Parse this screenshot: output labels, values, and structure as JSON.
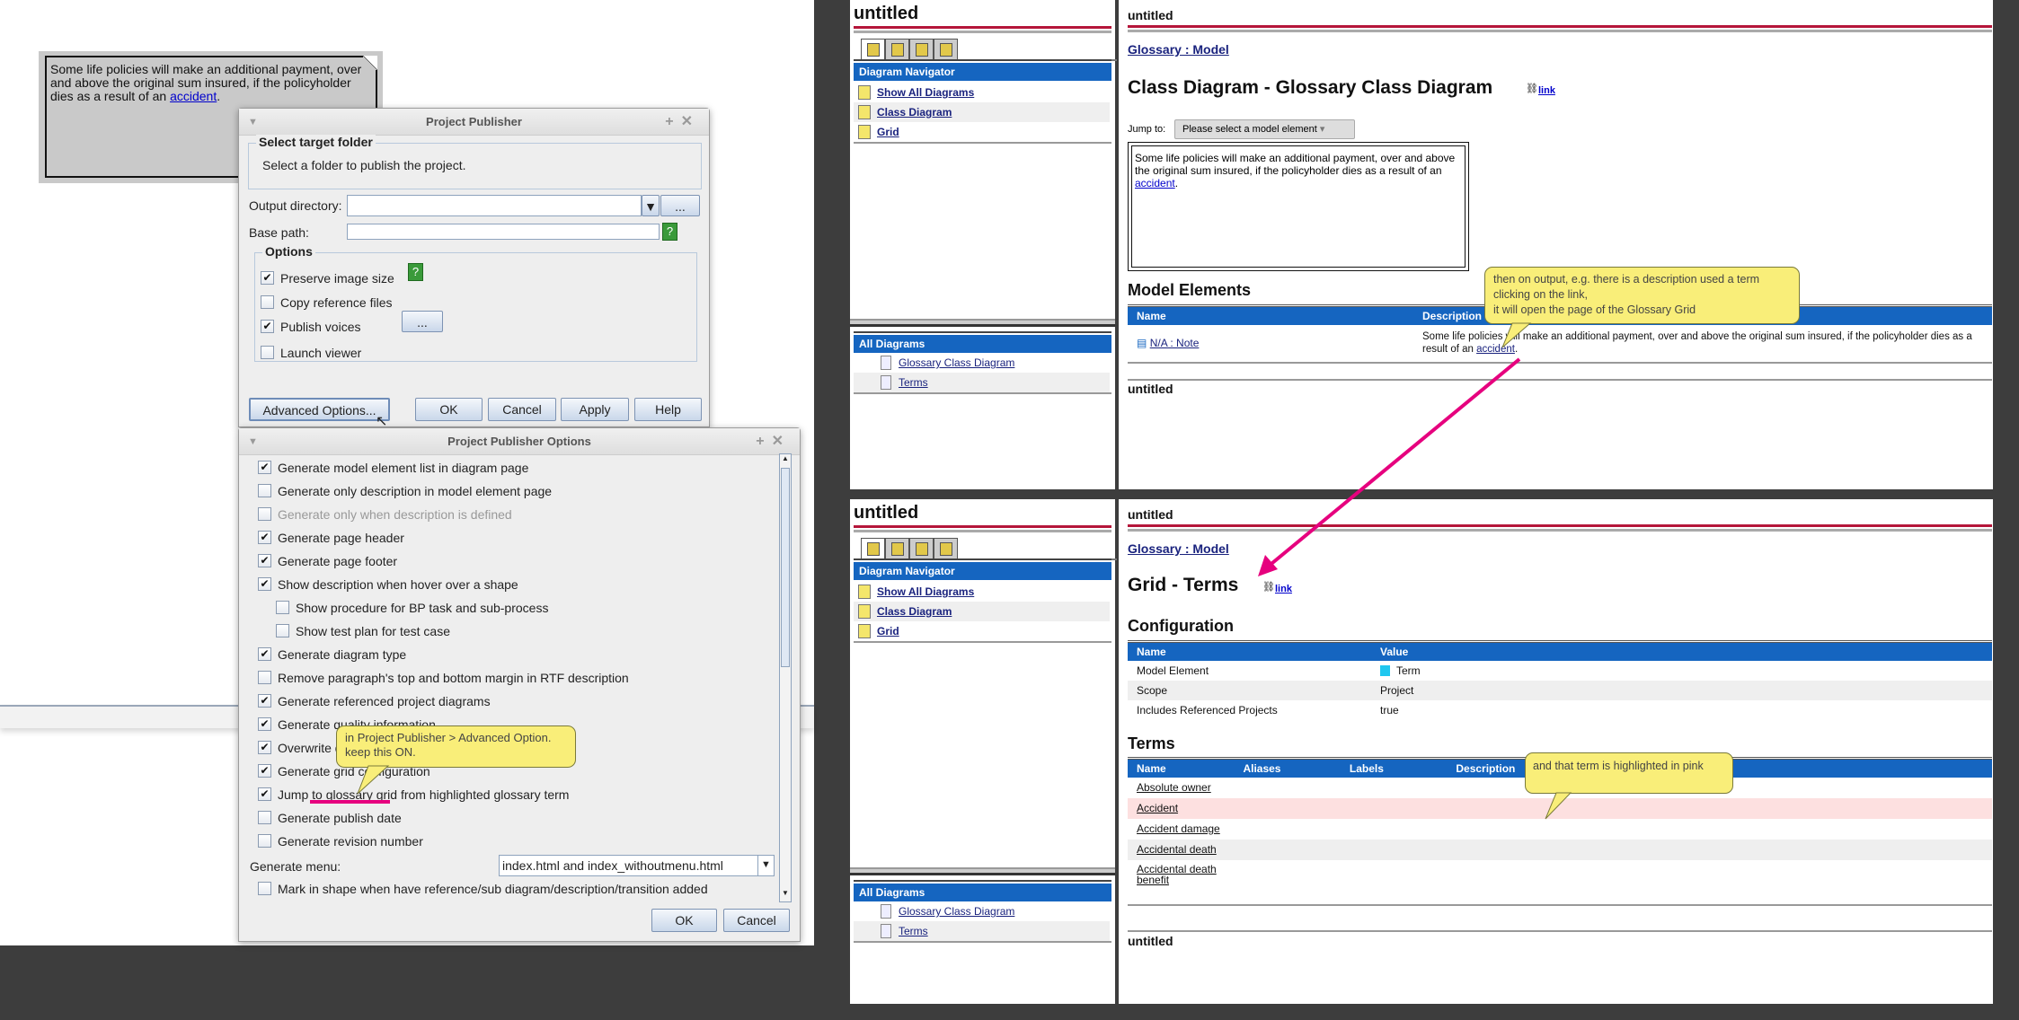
{
  "note": {
    "text": "Some life policies will make an additional payment, over and above the original sum insured, if the policyholder dies as a result of an ",
    "link": "accident",
    "end": "."
  },
  "publisher": {
    "title": "Project Publisher",
    "group_title": "Select target folder",
    "group_text": "Select a folder to publish the project.",
    "output_label": "Output directory:",
    "output_value": "",
    "browse": "...",
    "base_label": "Base path:",
    "base_value": "",
    "help": "?",
    "options_title": "Options",
    "options": [
      {
        "label": "Preserve image size",
        "checked": true
      },
      {
        "label": "Copy reference files",
        "checked": false
      },
      {
        "label": "Publish voices",
        "checked": true
      },
      {
        "label": "Launch viewer",
        "checked": false
      }
    ],
    "voices_btn": "...",
    "buttons": {
      "advanced": "Advanced Options...",
      "ok": "OK",
      "cancel": "Cancel",
      "apply": "Apply",
      "help": "Help"
    }
  },
  "adv": {
    "title": "Project Publisher Options",
    "options": [
      {
        "label": "Generate model element list in diagram page",
        "checked": true
      },
      {
        "label": "Generate only description in model element page",
        "checked": false
      },
      {
        "label": "Generate only when description is defined",
        "checked": false,
        "disabled": true
      },
      {
        "label": "Generate page header",
        "checked": true
      },
      {
        "label": "Generate page footer",
        "checked": true
      },
      {
        "label": "Show description when hover over a shape",
        "checked": true
      },
      {
        "label": "Show procedure for BP task and sub-process",
        "checked": false,
        "indent": true
      },
      {
        "label": "Show test plan for test case",
        "checked": false,
        "indent": true
      },
      {
        "label": "Generate diagram type",
        "checked": true
      },
      {
        "label": "Remove paragraph's top and bottom margin in RTF description",
        "checked": false
      },
      {
        "label": "Generate referenced project diagrams",
        "checked": true
      },
      {
        "label": "Generate quality information",
        "checked": true
      },
      {
        "label": "Overwrite do",
        "checked": true
      },
      {
        "label": "Generate grid configuration",
        "checked": true
      },
      {
        "label": "Jump to glossary grid from highlighted glossary term",
        "checked": true
      },
      {
        "label": "Generate publish date",
        "checked": false
      },
      {
        "label": "Generate revision number",
        "checked": false
      }
    ],
    "menu_label": "Generate menu:",
    "menu_value": "index.html and index_withoutmenu.html",
    "partial_row": "Mark in shape when have reference/sub diagram/description/transition added",
    "ok": "OK",
    "cancel": "Cancel",
    "callout": "in Project Publisher > Advanced Option.\nkeep this ON."
  },
  "web": {
    "site_title": "untitled",
    "nav_header": "Diagram Navigator",
    "nav_items": [
      "Show All Diagrams",
      "Class Diagram",
      "Grid"
    ],
    "all_header": "All Diagrams",
    "all_items": [
      "Glossary Class Diagram",
      "Terms"
    ],
    "breadcrumb": "Glossary : Model",
    "link": "link",
    "footer": "untitled",
    "page1": {
      "title": "Class Diagram - Glossary Class Diagram",
      "jump_label": "Jump to:",
      "jump_value": "Please select a model element",
      "note_text": "Some life policies will make an additional payment, over and above the original sum insured, if the policyholder dies as a result of an ",
      "note_link": "accident",
      "note_end": ".",
      "section": "Model Elements",
      "columns": [
        "Name",
        "Description"
      ],
      "row": {
        "name": "N/A : Note",
        "desc": "Some life policies will make an additional payment, over and above the original sum insured, if the policyholder dies as a result of an ",
        "desc_link": "accident",
        "desc_end": "."
      },
      "callout": "then on output, e.g. there is a description used a term\nclicking on the link,\nit will open the page of the Glossary Grid"
    },
    "page2": {
      "title": "Grid - Terms",
      "config_title": "Configuration",
      "config_columns": [
        "Name",
        "Value"
      ],
      "config_rows": [
        [
          "Model Element",
          "Term"
        ],
        [
          "Scope",
          "Project"
        ],
        [
          "Includes Referenced Projects",
          "true"
        ]
      ],
      "terms_title": "Terms",
      "terms_columns": [
        "Name",
        "Aliases",
        "Labels",
        "Description"
      ],
      "terms": [
        "Absolute owner",
        "Accident",
        "Accident damage",
        "Accidental death",
        "Accidental death benefit"
      ],
      "highlighted_term": "Accident",
      "callout": "and that term is highlighted in pink"
    }
  },
  "colors": {
    "annotation": "#e6007e",
    "highlight": "#fde0e0",
    "header_blue": "#1565c0",
    "title_red": "#b5163a",
    "callout": "#f9ee79"
  }
}
